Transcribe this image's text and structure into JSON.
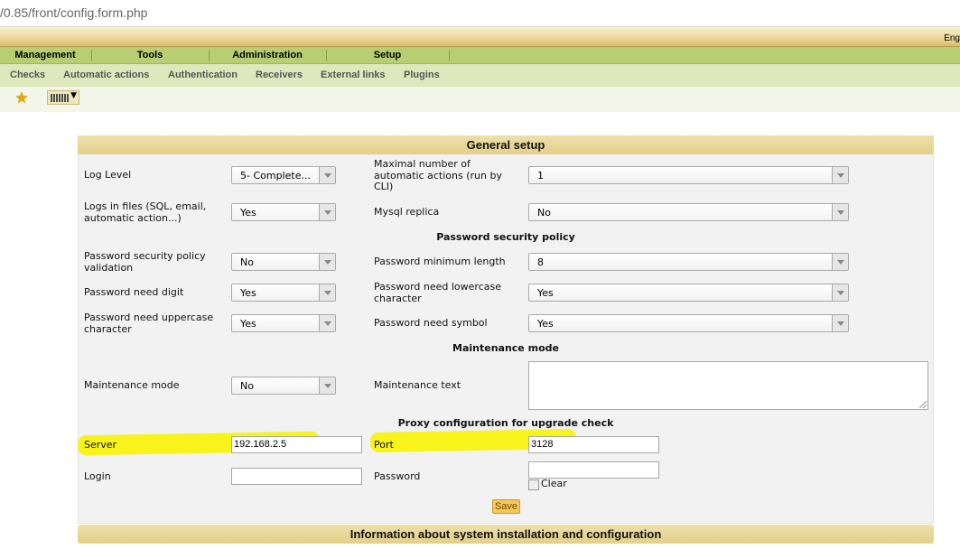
{
  "browser": {
    "url": "/0.85/front/config.form.php"
  },
  "topbar": {
    "language": "Eng"
  },
  "menu": {
    "items": [
      {
        "label": "Management"
      },
      {
        "label": "Tools"
      },
      {
        "label": "Administration"
      },
      {
        "label": "Setup"
      }
    ]
  },
  "submenu": {
    "items": [
      {
        "label": "Checks"
      },
      {
        "label": "Automatic actions"
      },
      {
        "label": "Authentication"
      },
      {
        "label": "Receivers"
      },
      {
        "label": "External links"
      },
      {
        "label": "Plugins"
      }
    ]
  },
  "toolbar": {
    "icons": [
      "star-icon",
      "list-view-icon"
    ]
  },
  "general": {
    "title": "General setup",
    "log_level": {
      "label": "Log Level",
      "value": "5- Complete..."
    },
    "max_actions": {
      "label": "Maximal number of automatic actions (run by CLI)",
      "value": "1"
    },
    "logs_in_files": {
      "label": "Logs in files (SQL, email, automatic action...)",
      "value": "Yes"
    },
    "mysql_replica": {
      "label": "Mysql replica",
      "value": "No"
    }
  },
  "password_policy": {
    "title": "Password security policy",
    "validation": {
      "label": "Password security policy validation",
      "value": "No"
    },
    "min_length": {
      "label": "Password minimum length",
      "value": "8"
    },
    "need_digit": {
      "label": "Password need digit",
      "value": "Yes"
    },
    "need_lowercase": {
      "label": "Password need lowercase character",
      "value": "Yes"
    },
    "need_uppercase": {
      "label": "Password need uppercase character",
      "value": "Yes"
    },
    "need_symbol": {
      "label": "Password need symbol",
      "value": "Yes"
    }
  },
  "maintenance": {
    "title": "Maintenance mode",
    "mode": {
      "label": "Maintenance mode",
      "value": "No"
    },
    "text": {
      "label": "Maintenance text",
      "value": ""
    }
  },
  "proxy": {
    "title": "Proxy configuration for upgrade check",
    "server": {
      "label": "Server",
      "value": "192.168.2.5"
    },
    "port": {
      "label": "Port",
      "value": "3128"
    },
    "login": {
      "label": "Login",
      "value": ""
    },
    "password": {
      "label": "Password",
      "value": "",
      "clear_label": "Clear"
    }
  },
  "actions": {
    "save_label": "Save"
  },
  "info": {
    "title": "Information about system installation and configuration"
  },
  "colors": {
    "menu": "#b7cf72",
    "submenu": "#dfe8bc",
    "header": "#e2cf8a",
    "highlight": "#f7f31b",
    "save": "#f8c75c"
  }
}
